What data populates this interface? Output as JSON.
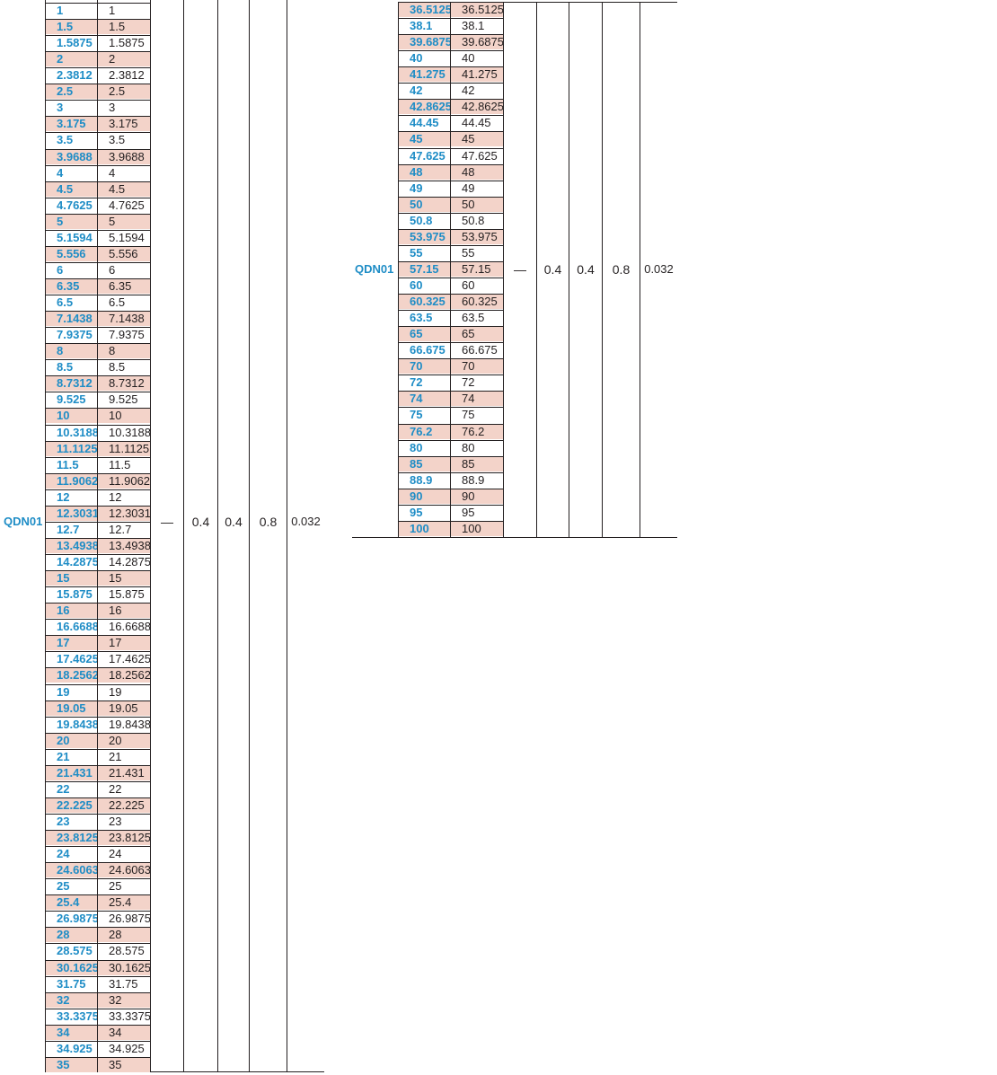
{
  "model": "QDN01",
  "params": [
    "—",
    "0.4",
    "0.4",
    "0.8",
    "0.032"
  ],
  "left_table": {
    "rows": [
      "1",
      "1.5",
      "1.5875",
      "2",
      "2.3812",
      "2.5",
      "3",
      "3.175",
      "3.5",
      "3.9688",
      "4",
      "4.5",
      "4.7625",
      "5",
      "5.1594",
      "5.556",
      "6",
      "6.35",
      "6.5",
      "7.1438",
      "7.9375",
      "8",
      "8.5",
      "8.7312",
      "9.525",
      "10",
      "10.3188",
      "11.1125",
      "11.5",
      "11.9062",
      "12",
      "12.3031",
      "12.7",
      "13.4938",
      "14.2875",
      "15",
      "15.875",
      "16",
      "16.6688",
      "17",
      "17.4625",
      "18.2562",
      "19",
      "19.05",
      "19.8438",
      "20",
      "21",
      "21.431",
      "22",
      "22.225",
      "23",
      "23.8125",
      "24",
      "24.6063",
      "25",
      "25.4",
      "26.9875",
      "28",
      "28.575",
      "30.1625",
      "31.75",
      "32",
      "33.3375",
      "34",
      "34.925",
      "35"
    ]
  },
  "right_table": {
    "rows": [
      "36.5125",
      "38.1",
      "39.6875",
      "40",
      "41.275",
      "42",
      "42.8625",
      "44.45",
      "45",
      "47.625",
      "48",
      "49",
      "50",
      "50.8",
      "53.975",
      "55",
      "57.15",
      "60",
      "60.325",
      "63.5",
      "65",
      "66.675",
      "70",
      "72",
      "74",
      "75",
      "76.2",
      "80",
      "85",
      "88.9",
      "90",
      "95",
      "100"
    ]
  },
  "colors": {
    "code_text": "#1f8dc6",
    "highlight_row": "#f3d3c9",
    "rule": "#231f20"
  }
}
